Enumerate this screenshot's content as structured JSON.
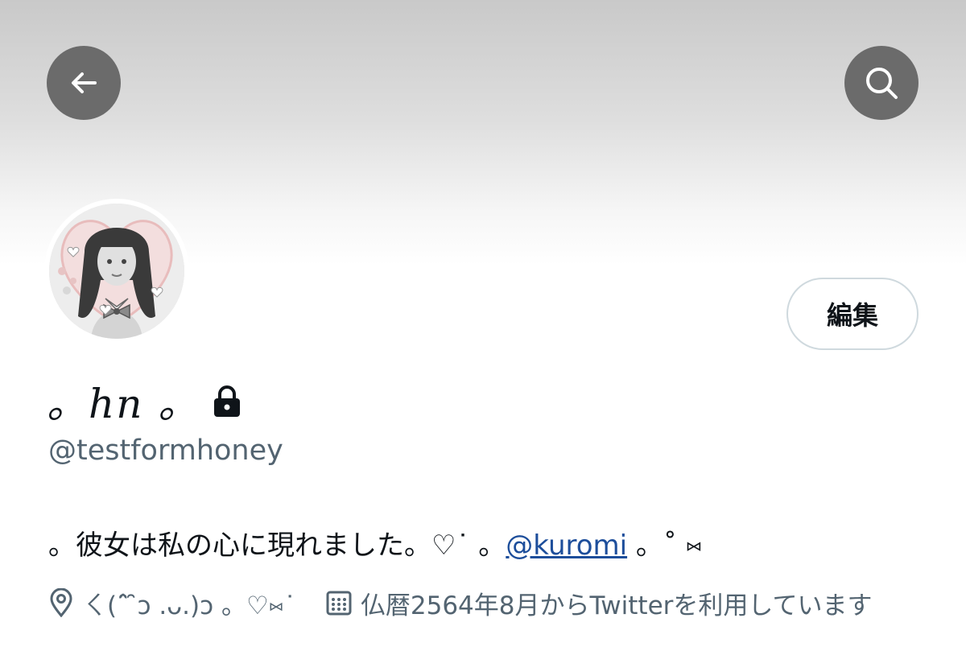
{
  "header": {
    "back_icon": "arrow-left-icon",
    "search_icon": "search-icon"
  },
  "profile": {
    "avatar_alt": "avatar",
    "edit_label": "編集",
    "display_name": "。ℎ𝑛 。",
    "protected_icon": "lock-icon",
    "handle": "@testformhoney",
    "bio_prefix": "。彼女は私の心に現れました。♡˙ 。",
    "bio_mention": "@kuromi",
    "bio_suffix": " 。˚ ⑅",
    "location_icon": "location-pin-icon",
    "location": "ㄑ(ˆ̑ ̑ɔ .ᴗ.)ɔ 。♡⑅˙",
    "joined_icon": "calendar-icon",
    "joined": "仏暦2564年8月からTwitterを利用しています"
  }
}
